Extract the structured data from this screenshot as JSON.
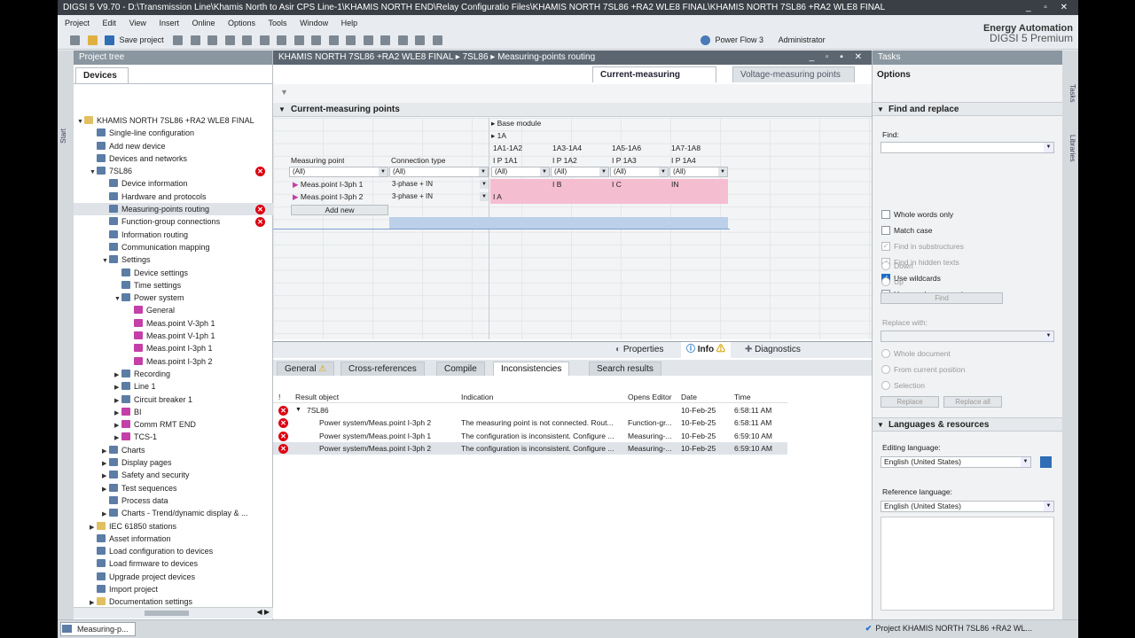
{
  "title": "DIGSI 5 V9.70  -  D:\\Transmission Line\\Khamis North to Asir CPS Line-1\\KHAMIS NORTH END\\Relay Configuratio Files\\KHAMIS NORTH 7SL86 +RA2 WLE8 FINAL\\KHAMIS NORTH 7SL86 +RA2 WLE8 FINAL",
  "title_controls": "_ ▫ ✕",
  "menu": [
    "Project",
    "Edit",
    "View",
    "Insert",
    "Online",
    "Options",
    "Tools",
    "Window",
    "Help"
  ],
  "toolbar": {
    "save_label": "Save project",
    "power_flow": "Power Flow 3",
    "user": "Administrator"
  },
  "brand": {
    "line1": "Energy Automation",
    "line2": "DIGSI 5 Premium"
  },
  "left": {
    "header": "Project tree",
    "tab": "Devices",
    "side_start": "Start",
    "scroll_glyphs": "◀ ▶",
    "tree": [
      {
        "label": "KHAMIS NORTH 7SL86 +RA2 WLE8 FINAL",
        "indent": 0,
        "arrow": "▼",
        "icon": "d"
      },
      {
        "label": "Single-line configuration",
        "indent": 1,
        "arrow": "",
        "icon": "n"
      },
      {
        "label": "Add new device",
        "indent": 1,
        "arrow": "",
        "icon": "n"
      },
      {
        "label": "Devices and networks",
        "indent": 1,
        "arrow": "",
        "icon": "n"
      },
      {
        "label": "7SL86",
        "indent": 1,
        "arrow": "▼",
        "icon": "n",
        "err": true
      },
      {
        "label": "Device information",
        "indent": 2,
        "arrow": "",
        "icon": "n"
      },
      {
        "label": "Hardware and protocols",
        "indent": 2,
        "arrow": "",
        "icon": "n"
      },
      {
        "label": "Measuring-points routing",
        "indent": 2,
        "arrow": "",
        "icon": "n",
        "err": true,
        "sel": true
      },
      {
        "label": "Function-group connections",
        "indent": 2,
        "arrow": "",
        "icon": "n",
        "err": true
      },
      {
        "label": "Information routing",
        "indent": 2,
        "arrow": "",
        "icon": "n"
      },
      {
        "label": "Communication mapping",
        "indent": 2,
        "arrow": "",
        "icon": "n"
      },
      {
        "label": "Settings",
        "indent": 2,
        "arrow": "▼",
        "icon": "n"
      },
      {
        "label": "Device settings",
        "indent": 3,
        "arrow": "",
        "icon": "n"
      },
      {
        "label": "Time settings",
        "indent": 3,
        "arrow": "",
        "icon": "n"
      },
      {
        "label": "Power system",
        "indent": 3,
        "arrow": "▼",
        "icon": "n"
      },
      {
        "label": "General",
        "indent": 4,
        "arrow": "",
        "icon": "m"
      },
      {
        "label": "Meas.point V-3ph 1",
        "indent": 4,
        "arrow": "",
        "icon": "m"
      },
      {
        "label": "Meas.point V-1ph 1",
        "indent": 4,
        "arrow": "",
        "icon": "m"
      },
      {
        "label": "Meas.point I-3ph 1",
        "indent": 4,
        "arrow": "",
        "icon": "m"
      },
      {
        "label": "Meas.point I-3ph 2",
        "indent": 4,
        "arrow": "",
        "icon": "m"
      },
      {
        "label": "Recording",
        "indent": 3,
        "arrow": "▶",
        "icon": "n"
      },
      {
        "label": "Line 1",
        "indent": 3,
        "arrow": "▶",
        "icon": "n"
      },
      {
        "label": "Circuit breaker 1",
        "indent": 3,
        "arrow": "▶",
        "icon": "n"
      },
      {
        "label": "BI",
        "indent": 3,
        "arrow": "▶",
        "icon": "m"
      },
      {
        "label": "Comm RMT END",
        "indent": 3,
        "arrow": "▶",
        "icon": "m"
      },
      {
        "label": "TCS-1",
        "indent": 3,
        "arrow": "▶",
        "icon": "m"
      },
      {
        "label": "Charts",
        "indent": 2,
        "arrow": "▶",
        "icon": "n"
      },
      {
        "label": "Display pages",
        "indent": 2,
        "arrow": "▶",
        "icon": "n"
      },
      {
        "label": "Safety and security",
        "indent": 2,
        "arrow": "▶",
        "icon": "n"
      },
      {
        "label": "Test sequences",
        "indent": 2,
        "arrow": "▶",
        "icon": "n"
      },
      {
        "label": "Process data",
        "indent": 2,
        "arrow": "",
        "icon": "n"
      },
      {
        "label": "Charts - Trend/dynamic display & ...",
        "indent": 2,
        "arrow": "▶",
        "icon": "n"
      },
      {
        "label": "IEC 61850 stations",
        "indent": 1,
        "arrow": "▶",
        "icon": "d"
      },
      {
        "label": "Asset information",
        "indent": 1,
        "arrow": "",
        "icon": "n"
      },
      {
        "label": "Load configuration to devices",
        "indent": 1,
        "arrow": "",
        "icon": "n"
      },
      {
        "label": "Load firmware to devices",
        "indent": 1,
        "arrow": "",
        "icon": "n"
      },
      {
        "label": "Upgrade project devices",
        "indent": 1,
        "arrow": "",
        "icon": "n"
      },
      {
        "label": "Import project",
        "indent": 1,
        "arrow": "",
        "icon": "n"
      },
      {
        "label": "Documentation settings",
        "indent": 1,
        "arrow": "▶",
        "icon": "d"
      }
    ]
  },
  "center": {
    "breadcrumb": "KHAMIS NORTH 7SL86 +RA2 WLE8 FINAL  ▸  7SL86  ▸  Measuring-points routing",
    "controls": "_ ▫ ▪ ✕",
    "tabs": {
      "current": "Current-measuring points",
      "voltage": "Voltage-measuring points"
    },
    "section": "Current-measuring points",
    "base_module": "Base module",
    "one_a": "1A",
    "col_groups": [
      "1A1-1A2",
      "1A3-1A4",
      "1A5-1A6",
      "1A7-1A8"
    ],
    "col_sub": [
      "I P 1A1",
      "I P 1A2",
      "I P 1A3",
      "I P 1A4"
    ],
    "headers": {
      "mp": "Measuring point",
      "conn": "Connection type"
    },
    "filter": "(All)",
    "rows": [
      {
        "name": "Meas.point I-3ph 1",
        "conn": "3-phase + IN",
        "c": [
          "",
          "I B",
          "I C",
          "IN"
        ]
      },
      {
        "name": "Meas.point I-3ph 2",
        "conn": "3-phase + IN",
        "c": [
          "I A",
          "",
          "",
          ""
        ]
      }
    ],
    "add_new": "Add new"
  },
  "inspector": {
    "props": "Properties",
    "info": "Info",
    "diag": "Diagnostics",
    "subtabs": [
      "General",
      "Cross-references",
      "Compile",
      "Inconsistencies",
      "Search results"
    ],
    "cols": [
      "!",
      "Result object",
      "Indication",
      "Opens Editor",
      "Date",
      "Time"
    ],
    "rows": [
      {
        "obj": "7SL86",
        "ind": "",
        "ed": "",
        "date": "10-Feb-25",
        "time": "6:58:11 AM",
        "group": true
      },
      {
        "obj": "Power system/Meas.point I-3ph 2",
        "ind": "The measuring point is not connected. Rout...",
        "ed": "Function-gr...",
        "date": "10-Feb-25",
        "time": "6:58:11 AM"
      },
      {
        "obj": "Power system/Meas.point I-3ph 1",
        "ind": "The configuration is inconsistent. Configure ...",
        "ed": "Measuring-...",
        "date": "10-Feb-25",
        "time": "6:59:10 AM"
      },
      {
        "obj": "Power system/Meas.point I-3ph 2",
        "ind": "The configuration is inconsistent. Configure ...",
        "ed": "Measuring-...",
        "date": "10-Feb-25",
        "time": "6:59:10 AM",
        "sel": true
      }
    ]
  },
  "right": {
    "header": "Tasks",
    "options": "Options",
    "find_replace": "Find and replace",
    "find_label": "Find:",
    "checks": [
      {
        "label": "Whole words only",
        "on": false,
        "dis": false
      },
      {
        "label": "Match case",
        "on": false,
        "dis": false
      },
      {
        "label": "Find in substructures",
        "on": true,
        "dis": true
      },
      {
        "label": "Find in hidden texts",
        "on": true,
        "dis": true
      },
      {
        "label": "Use wildcards",
        "on": true,
        "dis": false
      },
      {
        "label": "Use regular expressions",
        "on": false,
        "dis": false
      }
    ],
    "down": "Down",
    "up": "Up",
    "find_btn": "Find",
    "replace_with": "Replace with:",
    "radios": [
      "Whole document",
      "From current position",
      "Selection"
    ],
    "replace_btn": "Replace",
    "replace_all_btn": "Replace all",
    "lang_section": "Languages & resources",
    "editing_label": "Editing language:",
    "editing_value": "English (United States)",
    "reference_label": "Reference language:",
    "reference_value": "English (United States)",
    "side_tasks": "Tasks",
    "side_libraries": "Libraries"
  },
  "status": {
    "portal": "Measuring-p...",
    "message": "Project KHAMIS NORTH 7SL86 +RA2 WL..."
  }
}
